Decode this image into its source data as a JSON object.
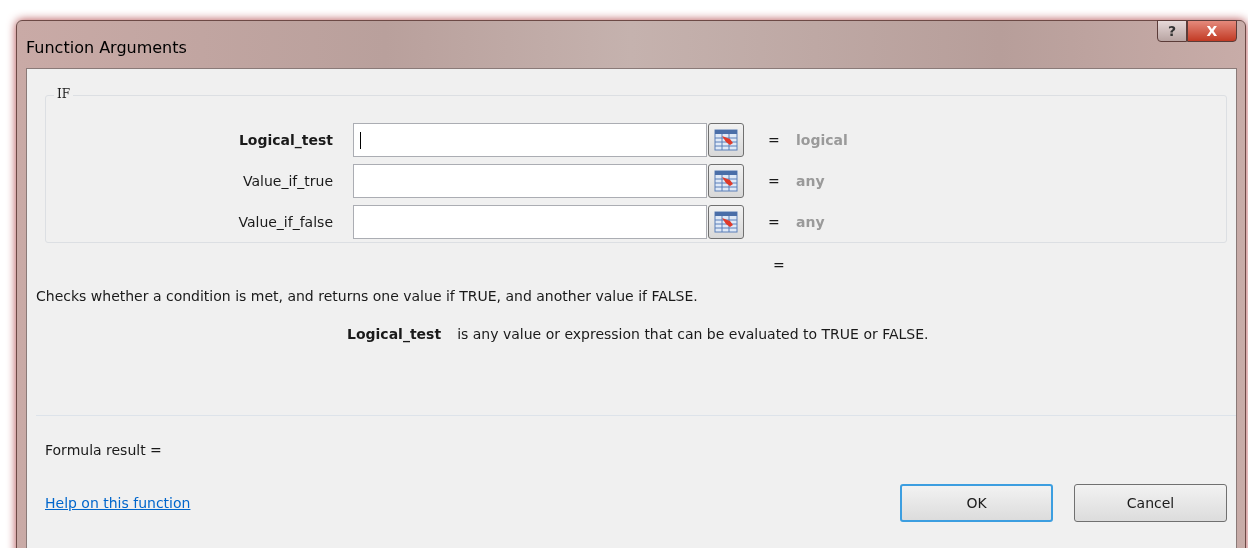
{
  "window": {
    "title": "Function Arguments"
  },
  "title_buttons": {
    "help": "?",
    "close": "X"
  },
  "function_group": {
    "label": "IF",
    "arguments": [
      {
        "name": "Logical_test",
        "selected": true,
        "result": "logical"
      },
      {
        "name": "Value_if_true",
        "selected": false,
        "result": "any"
      },
      {
        "name": "Value_if_false",
        "selected": false,
        "result": "any"
      }
    ]
  },
  "result_equals": "=",
  "equals_sign": "=",
  "description": "Checks whether a condition is met, and returns one value if TRUE, and another value if FALSE.",
  "argument_help": {
    "name": "Logical_test",
    "text": "is any value or expression that can be evaluated to TRUE or FALSE."
  },
  "formula_result": "Formula result =",
  "help_link": "Help on this function",
  "buttons": [
    {
      "label": "OK",
      "selected": true
    },
    {
      "label": "Cancel",
      "selected": false
    }
  ]
}
